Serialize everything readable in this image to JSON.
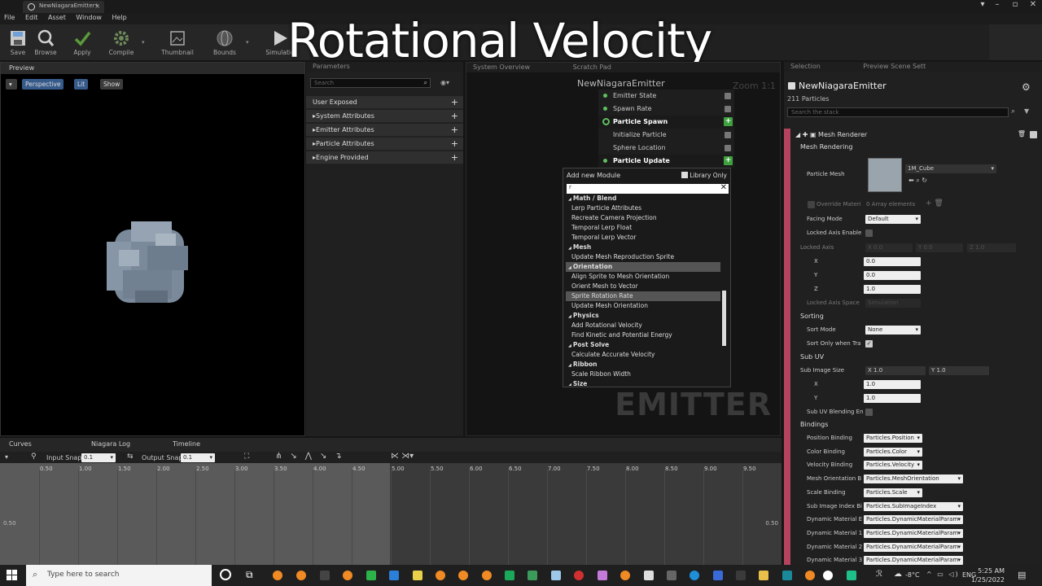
{
  "window": {
    "tab_title": "NewNiagaraEmitter*"
  },
  "menu": [
    "File",
    "Edit",
    "Asset",
    "Window",
    "Help"
  ],
  "toolbar": [
    {
      "label": "Save",
      "icon": "save-icon"
    },
    {
      "label": "Browse",
      "icon": "browse-icon"
    },
    {
      "label": "Apply",
      "icon": "apply-icon"
    },
    {
      "label": "Compile",
      "icon": "compile-icon"
    },
    {
      "label": "Thumbnail",
      "icon": "thumbnail-icon"
    },
    {
      "label": "Bounds",
      "icon": "bounds-icon"
    },
    {
      "label": "Simulatio",
      "icon": "simulation-icon"
    }
  ],
  "overlay_title": "Rotational Velocity",
  "preview": {
    "tab": "Preview",
    "buttons": [
      "Perspective",
      "Lit",
      "Show"
    ]
  },
  "parameters": {
    "tab": "Parameters",
    "search_placeholder": "Search",
    "rows": [
      "User Exposed",
      "System Attributes",
      "Emitter Attributes",
      "Particle Attributes",
      "Engine Provided"
    ]
  },
  "graph": {
    "tabs": [
      "System Overview",
      "Scratch Pad"
    ],
    "emitter_name": "NewNiagaraEmitter",
    "zoom": "Zoom 1:1",
    "watermark": "EMITTER",
    "nodes": [
      {
        "label": "Emitter State",
        "type": "item"
      },
      {
        "label": "Spawn Rate",
        "type": "item"
      },
      {
        "label": "Particle Spawn",
        "type": "header"
      },
      {
        "label": "Initialize Particle",
        "type": "item"
      },
      {
        "label": "Sphere Location",
        "type": "item"
      },
      {
        "label": "Particle Update",
        "type": "header"
      }
    ]
  },
  "popup": {
    "title": "Add new Module",
    "library_only": "Library Only",
    "search_value": "r",
    "items": [
      {
        "label": "Math / Blend",
        "cat": true
      },
      {
        "label": "Lerp Particle Attributes",
        "cat": false
      },
      {
        "label": "Recreate Camera Projection",
        "cat": false
      },
      {
        "label": "Temporal Lerp Float",
        "cat": false
      },
      {
        "label": "Temporal Lerp Vector",
        "cat": false
      },
      {
        "label": "Mesh",
        "cat": true
      },
      {
        "label": "Update Mesh Reproduction Sprite",
        "cat": false
      },
      {
        "label": "Orientation",
        "cat": true,
        "sel": true
      },
      {
        "label": "Align Sprite to Mesh Orientation",
        "cat": false
      },
      {
        "label": "Orient Mesh to Vector",
        "cat": false
      },
      {
        "label": "Sprite Rotation Rate",
        "cat": false,
        "sel": true
      },
      {
        "label": "Update Mesh Orientation",
        "cat": false
      },
      {
        "label": "Physics",
        "cat": true
      },
      {
        "label": "Add Rotational Velocity",
        "cat": false
      },
      {
        "label": "Find Kinetic and Potential Energy",
        "cat": false
      },
      {
        "label": "Post Solve",
        "cat": true
      },
      {
        "label": "Calculate Accurate Velocity",
        "cat": false
      },
      {
        "label": "Ribbon",
        "cat": true
      },
      {
        "label": "Scale Ribbon Width",
        "cat": false
      },
      {
        "label": "Size",
        "cat": true
      }
    ]
  },
  "details": {
    "tabs": [
      "Selection",
      "Preview Scene Sett"
    ],
    "emitter": "NewNiagaraEmitter",
    "particles": "211 Particles",
    "search_placeholder": "Search the stack",
    "renderer": "Mesh Renderer",
    "mesh_rendering": "Mesh Rendering",
    "particle_mesh_label": "Particle Mesh",
    "mesh_name": "1M_Cube",
    "override_label": "Override Materi",
    "array_elements": "0 Array elements",
    "facing_mode_label": "Facing Mode",
    "facing_mode": "Default",
    "locked_axis_enable": "Locked Axis Enable",
    "locked_axis": "Locked Axis",
    "locked_axis_vals": [
      "X 0.0",
      "Y 0.0",
      "Z 1.0"
    ],
    "xyz": [
      {
        "l": "X",
        "v": "0.0"
      },
      {
        "l": "Y",
        "v": "0.0"
      },
      {
        "l": "Z",
        "v": "1.0"
      }
    ],
    "locked_axis_space": "Locked Axis Space",
    "locked_axis_space_val": "Simulation",
    "sorting": "Sorting",
    "sort_mode_label": "Sort Mode",
    "sort_mode": "None",
    "sort_only": "Sort Only when Tra",
    "sub_uv": "Sub UV",
    "sub_image_size": "Sub Image Size",
    "sub_image_vals": [
      "X 1.0",
      "Y 1.0"
    ],
    "sub_xy": [
      {
        "l": "X",
        "v": "1.0"
      },
      {
        "l": "Y",
        "v": "1.0"
      }
    ],
    "sub_uv_blend": "Sub UV Blending En",
    "bindings": "Bindings",
    "binding_rows": [
      {
        "l": "Position Binding",
        "v": "Particles.Position"
      },
      {
        "l": "Color Binding",
        "v": "Particles.Color"
      },
      {
        "l": "Velocity Binding",
        "v": "Particles.Velocity"
      },
      {
        "l": "Mesh Orientation B",
        "v": "Particles.MeshOrientation"
      },
      {
        "l": "Scale Binding",
        "v": "Particles.Scale"
      },
      {
        "l": "Sub Image Index Bi",
        "v": "Particles.SubImageIndex"
      },
      {
        "l": "Dynamic Material E",
        "v": "Particles.DynamicMaterialParam"
      },
      {
        "l": "Dynamic Material 1",
        "v": "Particles.DynamicMaterialParam"
      },
      {
        "l": "Dynamic Material 2",
        "v": "Particles.DynamicMaterialParam"
      },
      {
        "l": "Dynamic Material 3",
        "v": "Particles.DynamicMaterialParam"
      }
    ]
  },
  "curves": {
    "tabs": [
      "Curves",
      "Niagara Log",
      "Timeline"
    ],
    "input_snap": "Input Snap",
    "input_snap_val": "0.1",
    "output_snap": "Output Snap",
    "output_snap_val": "0.1",
    "ticks": [
      "0.50",
      "1.00",
      "1.50",
      "2.00",
      "2.50",
      "3.00",
      "3.50",
      "4.00",
      "4.50",
      "5.00",
      "5.50",
      "6.00",
      "6.50",
      "7.00",
      "7.50",
      "8.00",
      "8.50",
      "9.00",
      "9.50"
    ],
    "y_label": "0.50"
  },
  "taskbar": {
    "search_placeholder": "Type here to search",
    "temp": "-8°C",
    "lang": "ENG",
    "time": "5:25 AM",
    "date": "1/25/2022"
  }
}
